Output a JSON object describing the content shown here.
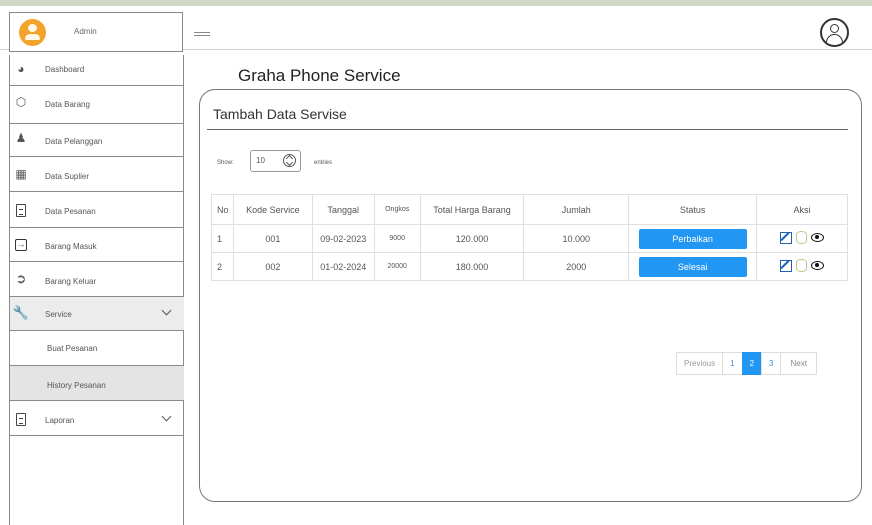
{
  "admin": {
    "label": "Admin"
  },
  "sidebar": {
    "items": [
      {
        "label": "Dashboard",
        "icon": "dashboard-icon"
      },
      {
        "label": "Data Barang",
        "icon": "box-icon"
      },
      {
        "label": "Data Pelanggan",
        "icon": "users-icon"
      },
      {
        "label": "Data Suplier",
        "icon": "building-icon"
      },
      {
        "label": "Data Pesanan",
        "icon": "clipboard-icon"
      },
      {
        "label": "Barang Masuk",
        "icon": "login-icon"
      },
      {
        "label": "Barang Keluar",
        "icon": "logout-icon"
      },
      {
        "label": "Service",
        "icon": "wrench-icon"
      }
    ],
    "service_sub": [
      {
        "label": "Buat Pesanan"
      },
      {
        "label": "History Pesanan"
      }
    ],
    "laporan": {
      "label": "Laporan",
      "icon": "document-icon"
    }
  },
  "page": {
    "title": "Graha Phone Service"
  },
  "card": {
    "title": "Tambah Data Servise"
  },
  "show": {
    "label": "Show:",
    "value": "10",
    "entries_label": "entries"
  },
  "table": {
    "headers": [
      "No",
      "Kode Service",
      "Tanggal",
      "Ongkos",
      "Total Harga Barang",
      "Jumlah",
      "Status",
      "Aksi"
    ],
    "rows": [
      {
        "no": "1",
        "kode": "001",
        "tanggal": "09-02-2023",
        "ongkos": "9000",
        "total": "120.000",
        "jumlah": "10.000",
        "status": "Perbaikan"
      },
      {
        "no": "2",
        "kode": "002",
        "tanggal": "01-02-2024",
        "ongkos": "20000",
        "total": "180.000",
        "jumlah": "2000",
        "status": "Selesai"
      }
    ]
  },
  "pagination": {
    "previous": "Previous",
    "pages": [
      "1",
      "2",
      "3"
    ],
    "active": "2",
    "next": "Next"
  },
  "colors": {
    "accent": "#2196f3",
    "avatar": "#f3a32a"
  }
}
